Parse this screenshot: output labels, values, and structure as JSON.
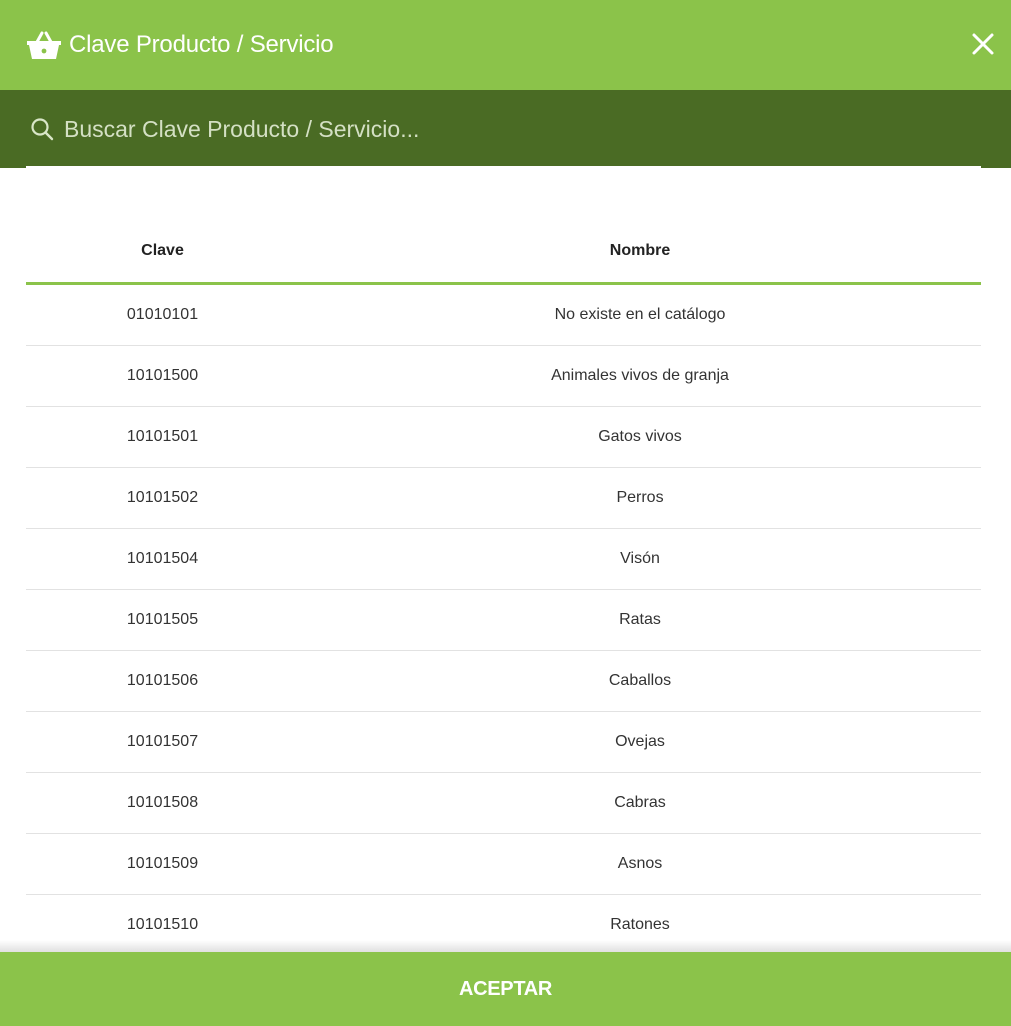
{
  "header": {
    "title": "Clave Producto / Servicio",
    "basket_icon": "shopping-basket-icon",
    "close_icon": "close-icon"
  },
  "search": {
    "placeholder": "Buscar Clave Producto / Servicio...",
    "value": "",
    "icon": "search-icon"
  },
  "table": {
    "columns": [
      "Clave",
      "Nombre"
    ],
    "rows": [
      {
        "clave": "01010101",
        "nombre": "No existe en el catálogo"
      },
      {
        "clave": "10101500",
        "nombre": "Animales vivos de granja"
      },
      {
        "clave": "10101501",
        "nombre": "Gatos vivos"
      },
      {
        "clave": "10101502",
        "nombre": "Perros"
      },
      {
        "clave": "10101504",
        "nombre": "Visón"
      },
      {
        "clave": "10101505",
        "nombre": "Ratas"
      },
      {
        "clave": "10101506",
        "nombre": "Caballos"
      },
      {
        "clave": "10101507",
        "nombre": "Ovejas"
      },
      {
        "clave": "10101508",
        "nombre": "Cabras"
      },
      {
        "clave": "10101509",
        "nombre": "Asnos"
      },
      {
        "clave": "10101510",
        "nombre": "Ratones"
      }
    ]
  },
  "footer": {
    "accept_label": "ACEPTAR"
  },
  "colors": {
    "header_green": "#8bc34a",
    "search_bar_green": "#4a6b24",
    "accent_line": "#8bc34a"
  }
}
